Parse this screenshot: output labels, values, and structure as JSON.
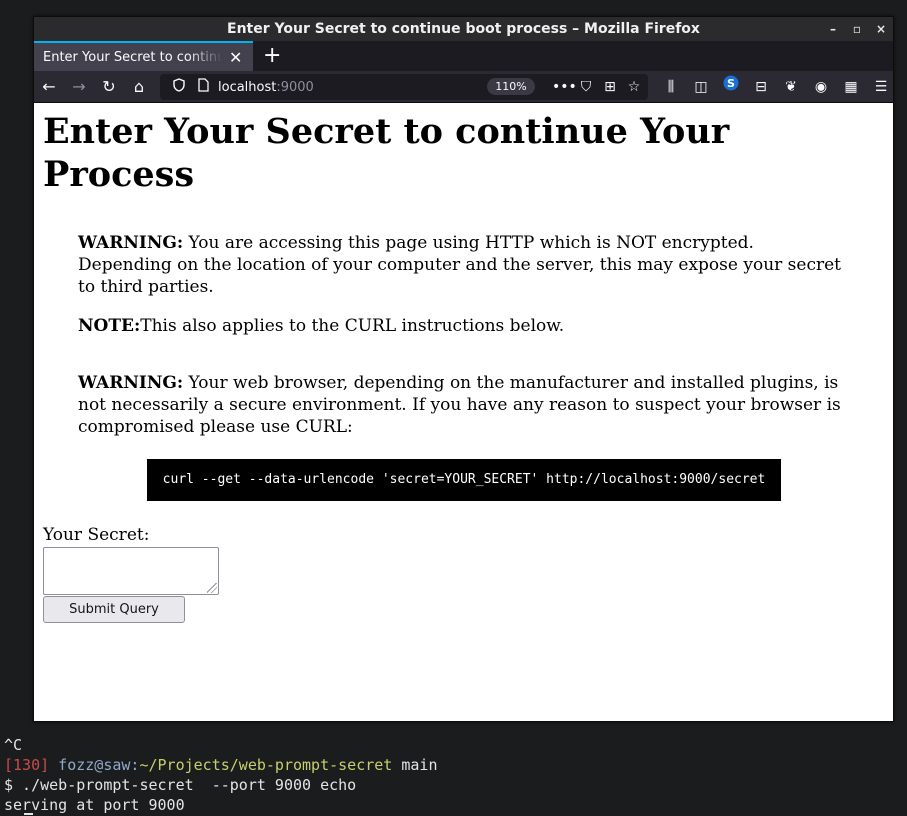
{
  "window": {
    "title": "Enter Your Secret to continue boot process – Mozilla Firefox",
    "controls": [
      "–",
      "▫",
      "×"
    ]
  },
  "tabs": [
    {
      "label": "Enter Your Secret to continue boot process",
      "close": "✕"
    }
  ],
  "new_tab": "+",
  "navbar": {
    "back": "←",
    "forward": "→",
    "reload": "↻",
    "home": "⌂",
    "url_host": "localhost",
    "url_port": ":9000",
    "zoom": "110%",
    "page_actions": [
      "•••",
      "⛉",
      "⊞",
      "☆"
    ],
    "toolbar_icons": [
      "⫼",
      "◫",
      "S",
      "⊟",
      "❦",
      "◉",
      "▦",
      "☰"
    ]
  },
  "page": {
    "heading": "Enter Your Secret to continue Your Process",
    "warning1_label": "WARNING:",
    "warning1_text": " You are accessing this page using HTTP which is NOT encrypted. Depending on the location of your computer and the server, this may expose your secret to third parties.",
    "note_label": "NOTE:",
    "note_text": "This also applies to the CURL instructions below.",
    "warning2_label": "WARNING:",
    "warning2_text": " Your web browser, depending on the manufacturer and installed plugins, is not necessarily a secure environment. If you have any reason to suspect your browser is compromised please use CURL:",
    "curl_command": "curl --get --data-urlencode 'secret=YOUR_SECRET' http://localhost:9000/secret",
    "secret_label": "Your Secret:",
    "secret_value": "",
    "submit_label": "Submit Query"
  },
  "terminal": {
    "line1": "^C",
    "exit_code": "[130]",
    "user_host": " fozz@saw:",
    "path": "~/Projects/web-prompt-secret",
    "branch": " main",
    "command": "$ ./web-prompt-secret  --port 9000 echo",
    "output": "serving at port 9000"
  }
}
